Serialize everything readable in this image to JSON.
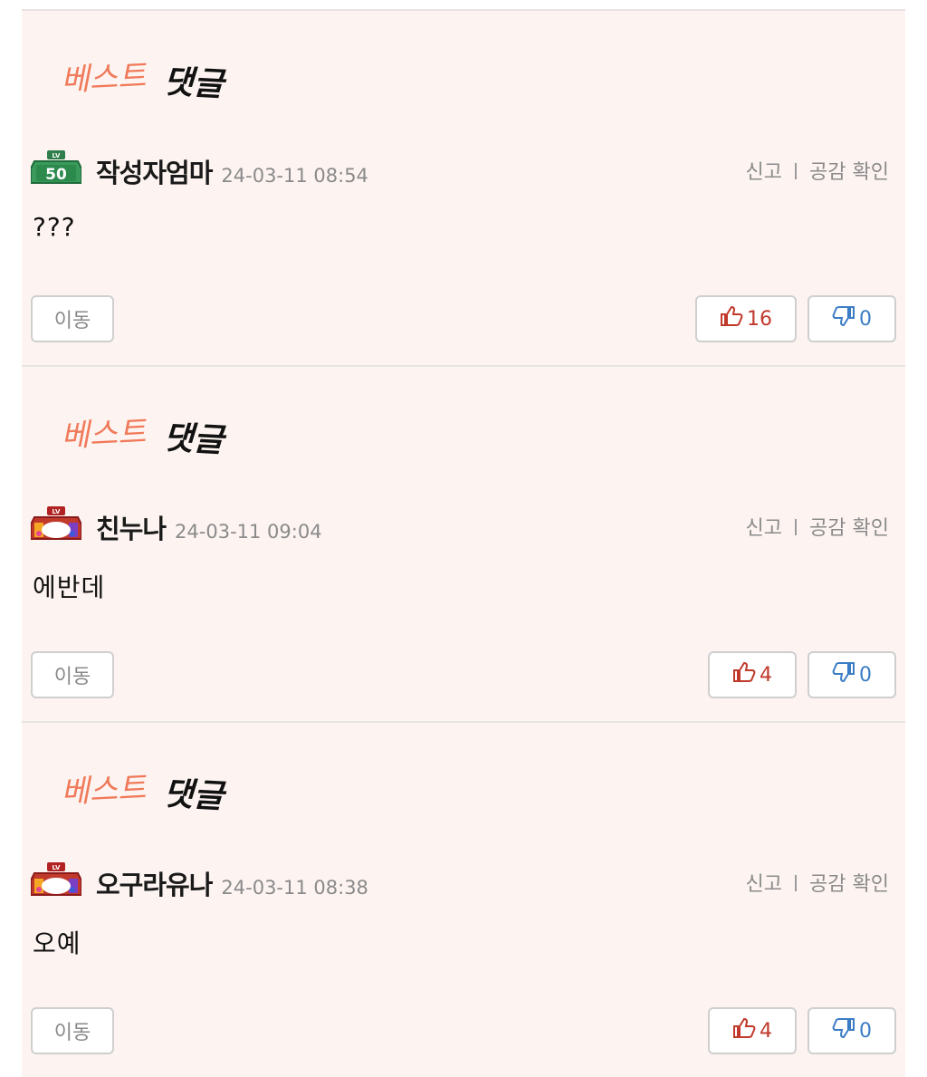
{
  "best_label": "베스트 댓글",
  "labels": {
    "report": "신고",
    "empathy_check": "공감 확인",
    "move": "이동"
  },
  "comments": [
    {
      "level": "50",
      "nickname": "작성자엄마",
      "date": "24-03-11 08:54",
      "text": "???",
      "likes": "16",
      "dislikes": "0"
    },
    {
      "level": "",
      "nickname": "친누나",
      "date": "24-03-11 09:04",
      "text": "에반데",
      "likes": "4",
      "dislikes": "0"
    },
    {
      "level": "",
      "nickname": "오구라유나",
      "date": "24-03-11 08:38",
      "text": "오예",
      "likes": "4",
      "dislikes": "0"
    }
  ],
  "colors": {
    "card_bg": "#fdf4f1",
    "best_orange": "#f07a5a",
    "like_red": "#c0392b",
    "dislike_blue": "#3b7dc4"
  }
}
